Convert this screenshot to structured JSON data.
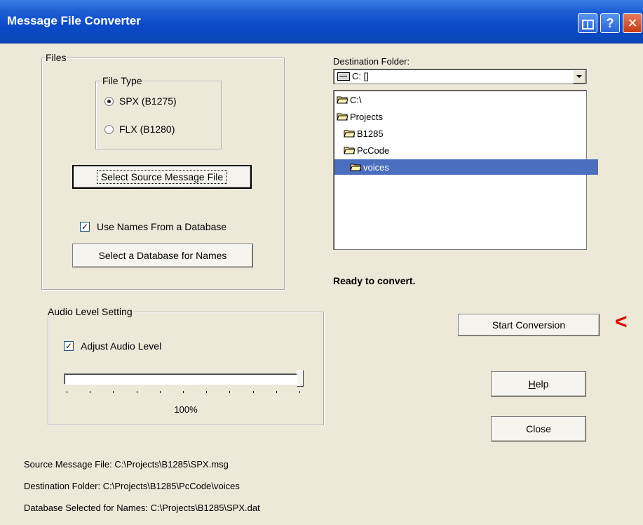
{
  "window": {
    "title": "Message File Converter",
    "title_buttons": {
      "help": "?",
      "close": "✕"
    }
  },
  "files_group": {
    "legend": "Files",
    "file_type": {
      "legend": "File Type",
      "options": [
        {
          "label": "SPX (B1275)",
          "selected": true
        },
        {
          "label": "FLX (B1280)",
          "selected": false
        }
      ]
    },
    "select_source_button": "Select Source Message File",
    "use_names_checkbox": {
      "label": "Use Names From a Database",
      "checked": true,
      "mark": "✓"
    },
    "select_database_button": "Select a Database for Names"
  },
  "audio_group": {
    "legend": "Audio Level Setting",
    "adjust_checkbox": {
      "label": "Adjust Audio Level",
      "checked": true,
      "mark": "✓"
    },
    "slider": {
      "value_fraction": 1.0,
      "tick_count": 11
    },
    "level_text": "100%"
  },
  "destination": {
    "label": "Destination Folder:",
    "drive": "C: []",
    "folders": [
      {
        "name": "C:\\",
        "depth": 0,
        "selected": false
      },
      {
        "name": "Projects",
        "depth": 0,
        "selected": false
      },
      {
        "name": "B1285",
        "depth": 1,
        "selected": false
      },
      {
        "name": "PcCode",
        "depth": 1,
        "selected": false
      },
      {
        "name": "voices",
        "depth": 2,
        "selected": true
      }
    ]
  },
  "status": "Ready to convert.",
  "buttons": {
    "start": "Start Conversion",
    "help": "Help",
    "help_mnemonic": "H",
    "close": "Close"
  },
  "arrow": "<",
  "info": {
    "source": "Source Message File: C:\\Projects\\B1285\\SPX.msg",
    "destination": "Destination Folder: C:\\Projects\\B1285\\PcCode\\voices",
    "database": "Database Selected for Names: C:\\Projects\\B1285\\SPX.dat"
  },
  "colors": {
    "titlebar": "#0a4ac8",
    "dialog_bg": "#ece9d8",
    "selection": "#4a6fbf",
    "arrow": "#e00000"
  }
}
